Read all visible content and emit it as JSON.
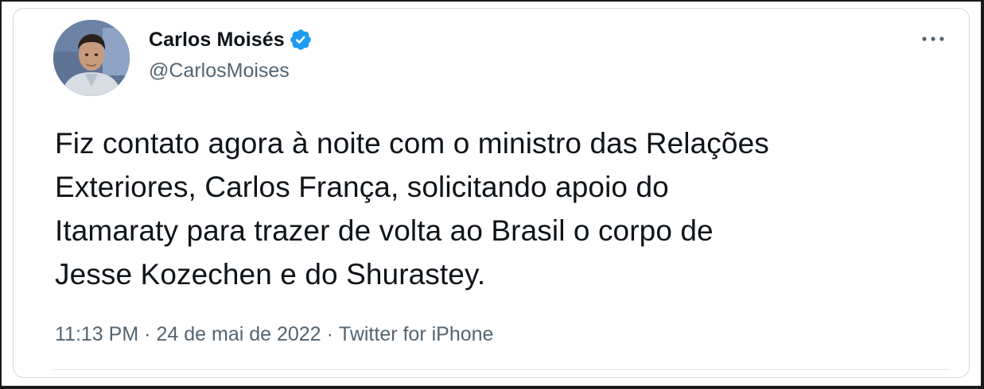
{
  "author": {
    "display_name": "Carlos Moisés",
    "handle": "@CarlosMoises",
    "verified": true
  },
  "tweet": {
    "text": "Fiz contato agora à noite com o ministro das Relações\nExteriores, Carlos França, solicitando apoio do\nItamaraty para trazer de volta ao Brasil o corpo de\nJesse Kozechen e do Shurastey.",
    "time": "11:13 PM",
    "date": "24 de mai de 2022",
    "source": "Twitter for iPhone",
    "separator": "·"
  },
  "icons": {
    "verified": "verified-badge-icon",
    "more": "more-options-icon",
    "avatar": "profile-photo"
  },
  "colors": {
    "verified_blue": "#1d9bf0",
    "primary_text": "#0f1419",
    "secondary_text": "#536471",
    "border": "#cfd9de"
  }
}
